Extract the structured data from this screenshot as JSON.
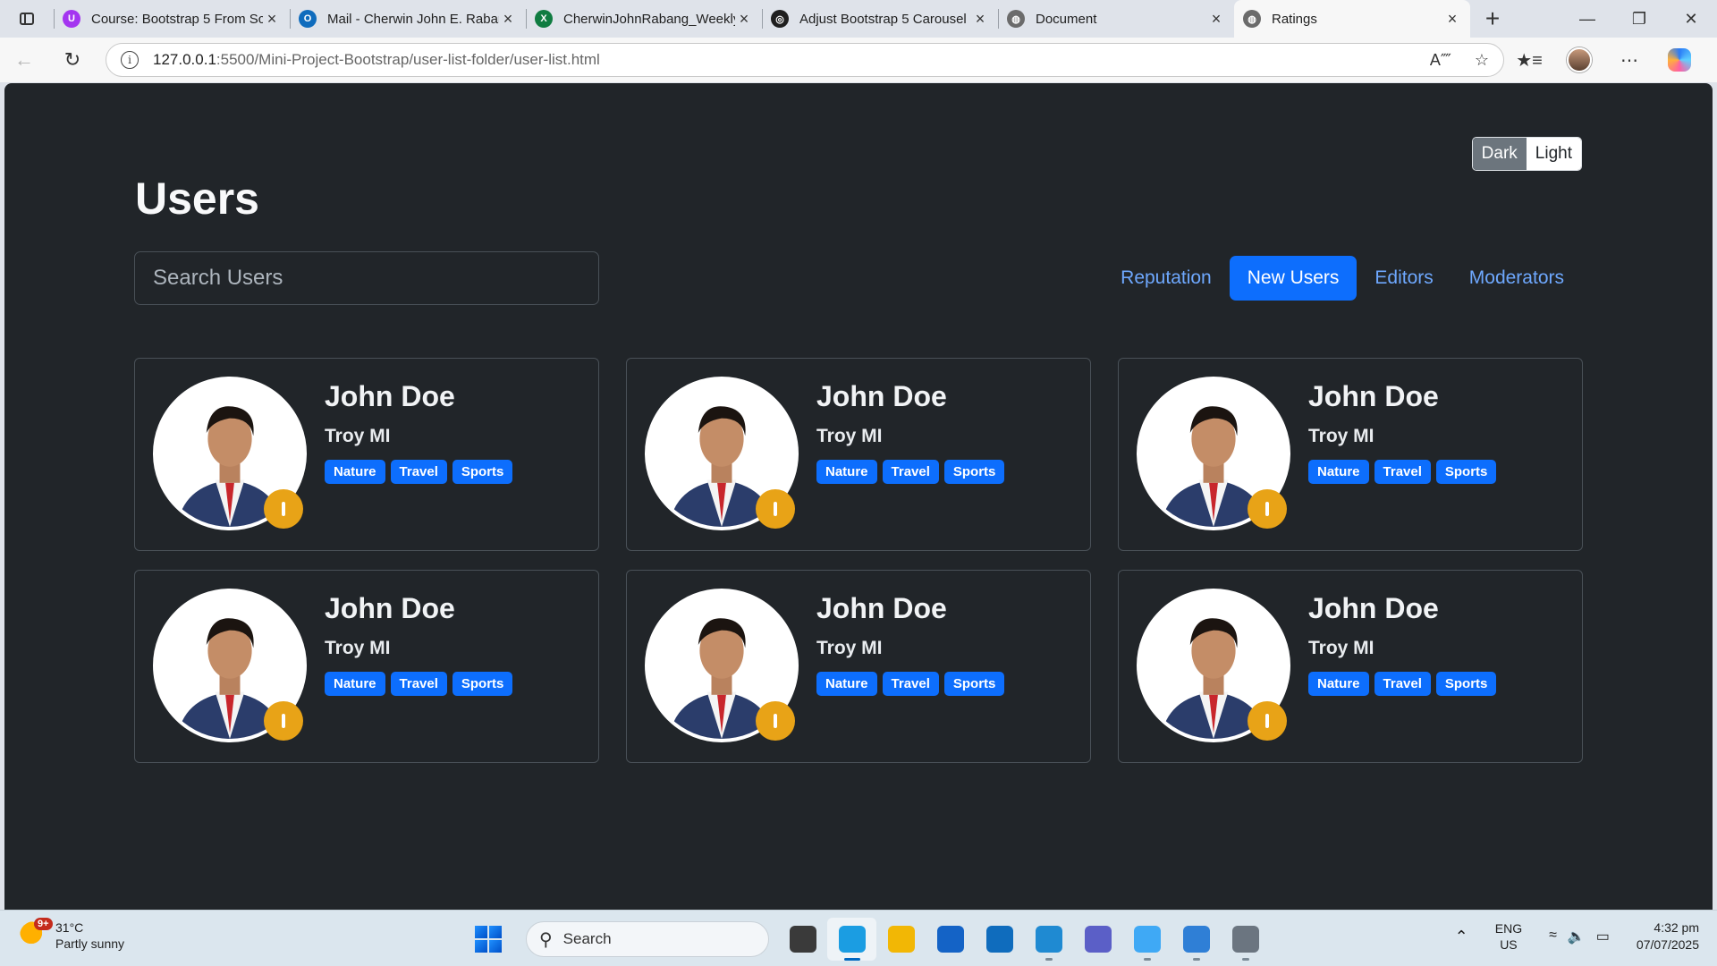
{
  "browser": {
    "tabs": [
      {
        "title": "Course: Bootstrap 5 From Sc",
        "icon": "udemy-icon",
        "color": "#a435f0",
        "glyph": "U",
        "active": false
      },
      {
        "title": "Mail - Cherwin John E. Rabang",
        "icon": "outlook-icon",
        "color": "#0f6cbd",
        "glyph": "O",
        "active": false
      },
      {
        "title": "CherwinJohnRabang_Weekly",
        "icon": "excel-icon",
        "color": "#107c41",
        "glyph": "X",
        "active": false
      },
      {
        "title": "Adjust Bootstrap 5 Carousel",
        "icon": "chatgpt-icon",
        "color": "#1f1f1f",
        "glyph": "◎",
        "active": false
      },
      {
        "title": "Document",
        "icon": "globe-icon",
        "color": "#6b6b6b",
        "glyph": "◍",
        "active": false
      },
      {
        "title": "Ratings",
        "icon": "globe-icon",
        "color": "#6b6b6b",
        "glyph": "◍",
        "active": true
      }
    ],
    "url_host": "127.0.0.1",
    "url_path": ":5500/Mini-Project-Bootstrap/user-list-folder/user-list.html"
  },
  "page": {
    "theme_toggle": {
      "dark_label": "Dark",
      "light_label": "Light"
    },
    "title": "Users",
    "search": {
      "placeholder": "Search Users"
    },
    "filters": [
      {
        "label": "Reputation",
        "active": false
      },
      {
        "label": "New Users",
        "active": true
      },
      {
        "label": "Editors",
        "active": false
      },
      {
        "label": "Moderators",
        "active": false
      }
    ],
    "users": [
      {
        "name": "John Doe",
        "location": "Troy MI",
        "tags": [
          "Nature",
          "Travel",
          "Sports"
        ]
      },
      {
        "name": "John Doe",
        "location": "Troy MI",
        "tags": [
          "Nature",
          "Travel",
          "Sports"
        ]
      },
      {
        "name": "John Doe",
        "location": "Troy MI",
        "tags": [
          "Nature",
          "Travel",
          "Sports"
        ]
      },
      {
        "name": "John Doe",
        "location": "Troy MI",
        "tags": [
          "Nature",
          "Travel",
          "Sports"
        ]
      },
      {
        "name": "John Doe",
        "location": "Troy MI",
        "tags": [
          "Nature",
          "Travel",
          "Sports"
        ]
      },
      {
        "name": "John Doe",
        "location": "Troy MI",
        "tags": [
          "Nature",
          "Travel",
          "Sports"
        ]
      }
    ],
    "colors": {
      "background": "#212529",
      "accent": "#0d6efd",
      "link": "#6ea8fe",
      "badge": "#e8a317"
    }
  },
  "taskbar": {
    "weather": {
      "badge": "9+",
      "temp": "31°C",
      "condition": "Partly sunny"
    },
    "search_label": "Search",
    "apps": [
      {
        "name": "file-explorer-task-icon",
        "color": "#3a3a3a",
        "active": false,
        "running": false
      },
      {
        "name": "edge-browser-task-icon",
        "color": "#1b9de2",
        "active": true,
        "running": true
      },
      {
        "name": "folder-task-icon",
        "color": "#f2b705",
        "active": false,
        "running": false
      },
      {
        "name": "microsoft-store-task-icon",
        "color": "#1463c6",
        "active": false,
        "running": false
      },
      {
        "name": "outlook-task-icon",
        "color": "#0f6cbd",
        "active": false,
        "running": false
      },
      {
        "name": "vscode-task-icon",
        "color": "#1f8ad2",
        "active": false,
        "running": true
      },
      {
        "name": "teams-task-icon",
        "color": "#5b5fc7",
        "active": false,
        "running": false
      },
      {
        "name": "chrome-like-task-icon",
        "color": "#3fa9f5",
        "active": false,
        "running": true
      },
      {
        "name": "photos-task-icon",
        "color": "#2f7fd6",
        "active": false,
        "running": true
      },
      {
        "name": "settings-task-icon",
        "color": "#6b7580",
        "active": false,
        "running": true
      }
    ],
    "language": {
      "line1": "ENG",
      "line2": "US"
    },
    "clock": {
      "time": "4:32 pm",
      "date": "07/07/2025"
    }
  }
}
